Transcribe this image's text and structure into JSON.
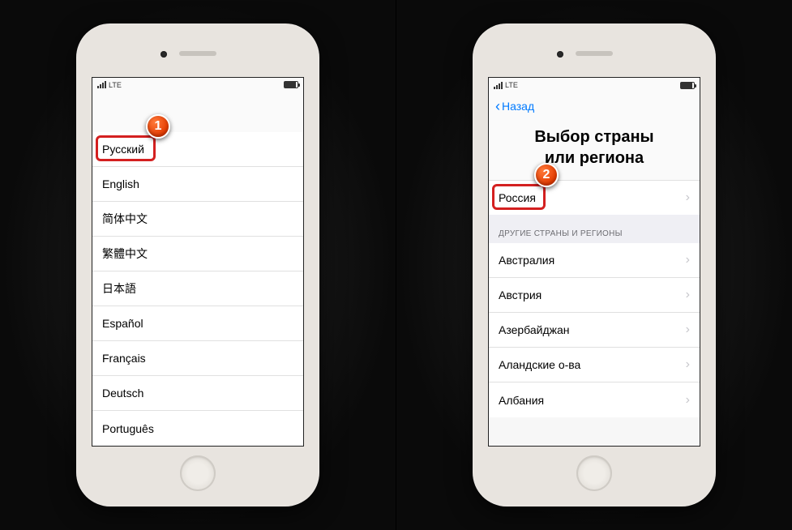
{
  "status": {
    "carrier": "LTE"
  },
  "callouts": {
    "one": "1",
    "two": "2"
  },
  "left": {
    "languages": [
      "Русский",
      "English",
      "简体中文",
      "繁體中文",
      "日本語",
      "Español",
      "Français",
      "Deutsch",
      "Português"
    ]
  },
  "right": {
    "back_label": "Назад",
    "title_line1": "Выбор страны",
    "title_line2": "или региона",
    "suggested": "Россия",
    "other_header": "ДРУГИЕ СТРАНЫ И РЕГИОНЫ",
    "countries": [
      "Австралия",
      "Австрия",
      "Азербайджан",
      "Аландские о-ва",
      "Албания"
    ]
  }
}
